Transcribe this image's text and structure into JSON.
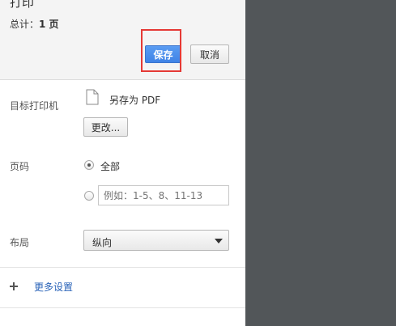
{
  "header": {
    "title": "打印",
    "total_prefix": "总计：",
    "total_count": "1 页",
    "save_label": "保存",
    "cancel_label": "取消"
  },
  "destination": {
    "label": "目标打印机",
    "name": "另存为 PDF",
    "change_label": "更改...",
    "icon": "file-icon"
  },
  "pages": {
    "label": "页码",
    "all_label": "全部",
    "all_selected": true,
    "custom_placeholder": "例如：1-5、8、11-13"
  },
  "layout": {
    "label": "布局",
    "selected": "纵向"
  },
  "more_settings": {
    "label": "更多设置",
    "icon": "plus-icon"
  },
  "colors": {
    "primary_button": "#4a8eef",
    "highlight_box": "#e53935",
    "link": "#2a63b8",
    "preview_background": "#525659"
  }
}
